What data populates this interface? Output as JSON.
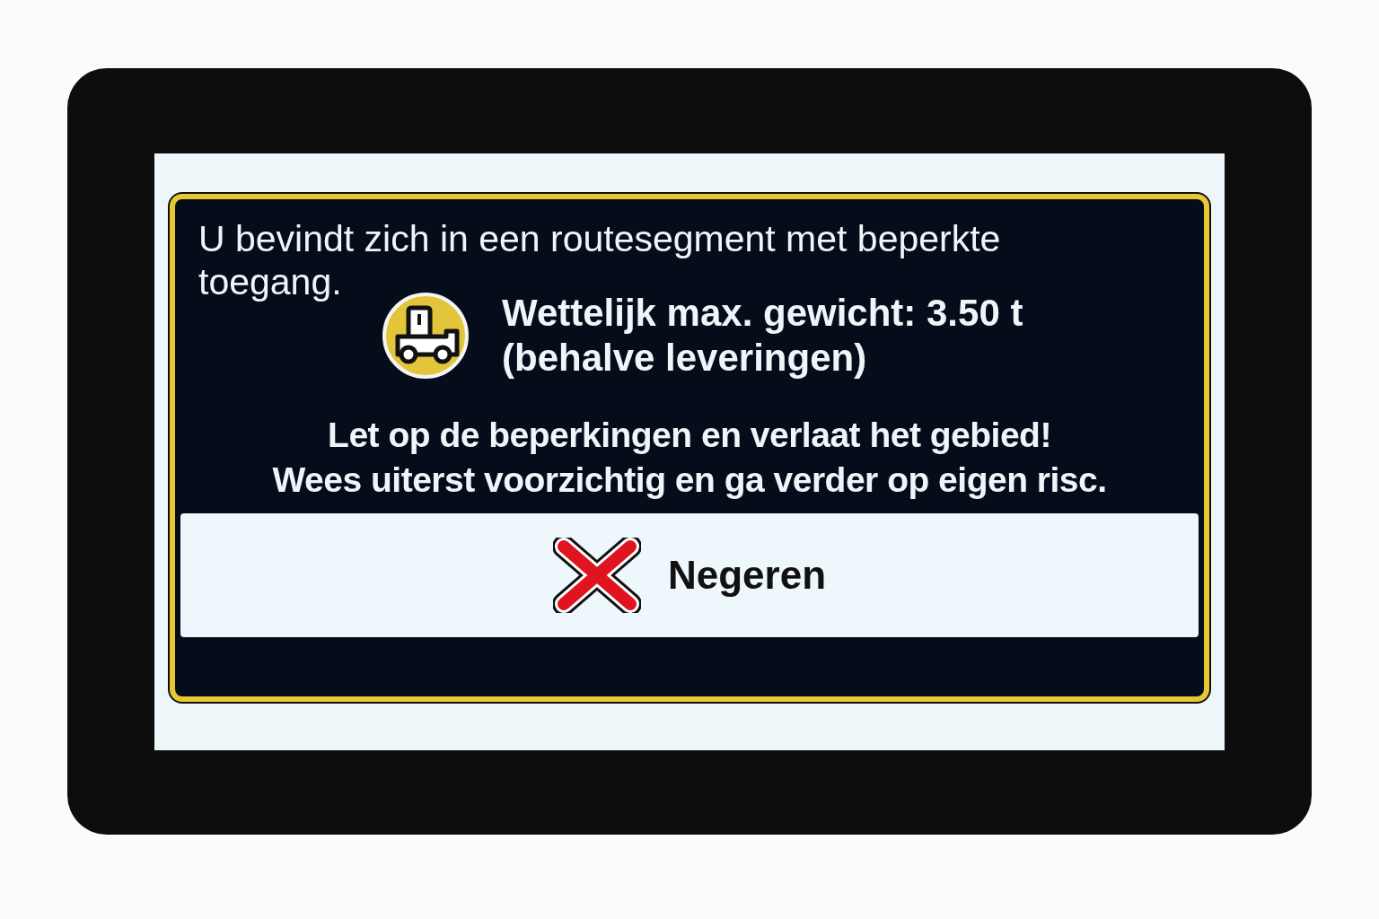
{
  "dialog": {
    "message": "U bevindt zich in een routesegment met beperkte toegang.",
    "restriction": {
      "lines": [
        "Wettelijk max. gewicht: 3.50 t",
        "(behalve leveringen)"
      ]
    },
    "warning": [
      "Let op de beperkingen en verlaat het gebied!",
      "Wees uiterst voorzichtig en ga verder op eigen risc."
    ],
    "button": {
      "label": "Negeren"
    }
  }
}
